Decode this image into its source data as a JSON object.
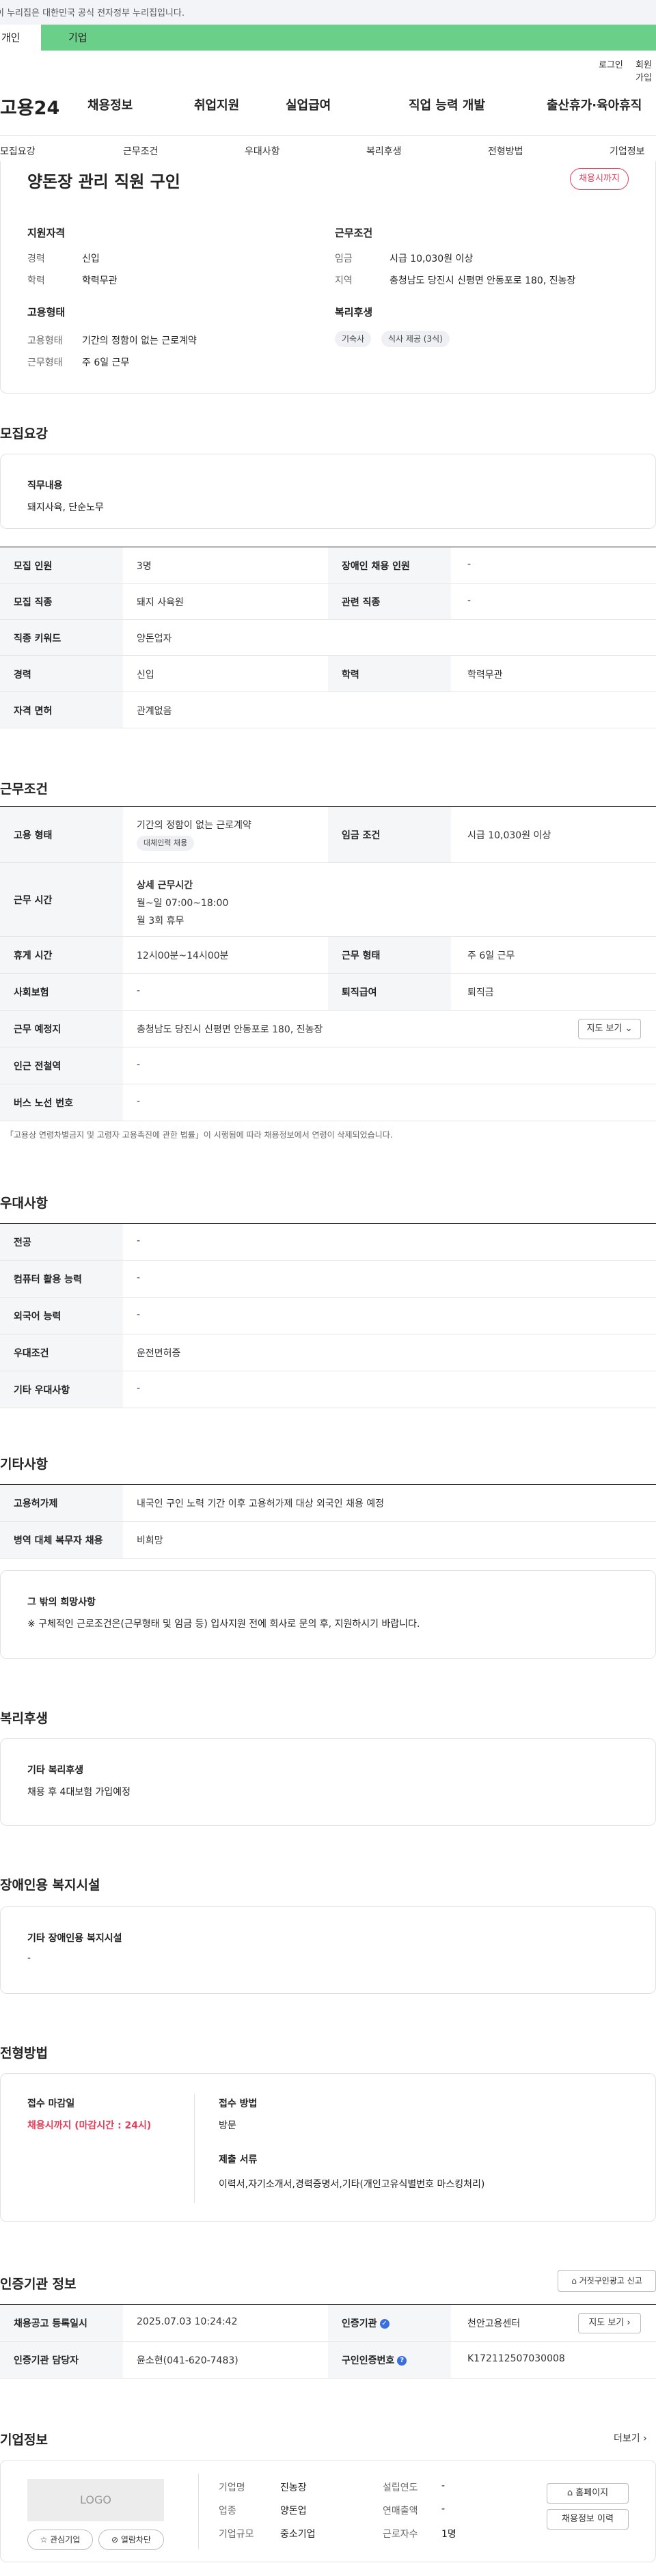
{
  "gov_banner": "이 누리집은 대한민국 공식 전자정부 누리집입니다.",
  "top_tabs": [
    "개인",
    "기업"
  ],
  "util": {
    "login": "로그인",
    "join": "회원가입"
  },
  "site": {
    "logo": "고용24"
  },
  "gnb": [
    "채용정보",
    "취업지원",
    "실업급여",
    "직업 능력 개발",
    "출산휴가·육아휴직"
  ],
  "subnav": [
    "모집요강",
    "근무조건",
    "우대사항",
    "복리후생",
    "전형방법",
    "기업정보"
  ],
  "job": {
    "title": "양돈장 관리 직원 구인",
    "status": "채용시까지",
    "qual_title": "지원자격",
    "qual": [
      {
        "k": "경력",
        "v": "신입"
      },
      {
        "k": "학력",
        "v": "학력무관"
      }
    ],
    "cond_title": "근무조건",
    "cond": [
      {
        "k": "임금",
        "v": "시급 10,030원 이상"
      },
      {
        "k": "지역",
        "v": "충청남도 당진시 신평면 안동포로 180, 진농장"
      }
    ],
    "type_title": "고용형태",
    "type": [
      {
        "k": "고용형태",
        "v": "기간의 정함이 없는 근로계약"
      },
      {
        "k": "근무형태",
        "v": "주 6일 근무"
      }
    ],
    "welfare_title": "복리후생",
    "welfare_chips": [
      "기숙사",
      "식사 제공 (3식)"
    ]
  },
  "recruit": {
    "title": "모집요강",
    "duty_label": "직무내용",
    "duty_value": "돼지사육, 단순노무",
    "rows": [
      {
        "k1": "모집 인원",
        "v1": "3명",
        "k2": "장애인 채용 인원",
        "v2": "-"
      },
      {
        "k1": "모집 직종",
        "v1": "돼지 사육원",
        "k2": "관련 직종",
        "v2": "-"
      },
      {
        "k1": "직종 키워드",
        "v1": "양돈업자"
      },
      {
        "k1": "경력",
        "v1": "신입",
        "k2": "학력",
        "v2": "학력무관"
      },
      {
        "k1": "자격 면허",
        "v1": "관계없음"
      }
    ]
  },
  "work": {
    "title": "근무조건",
    "employ_k": "고용 형태",
    "employ_v": "기간의 정함이 없는 근로계약",
    "employ_chip": "대체인력 채용",
    "wage_k": "임금 조건",
    "wage_v": "시급 10,030원 이상",
    "hours_k": "근무 시간",
    "hours_label": "상세 근무시간",
    "hours_v1": "월~일 07:00~18:00",
    "hours_v2": "월 3회 휴무",
    "rest_k": "휴게 시간",
    "rest_v": "12시00분~14시00분",
    "shift_k": "근무 형태",
    "shift_v": "주 6일 근무",
    "ins_k": "사회보험",
    "ins_v": "-",
    "sev_k": "퇴직급여",
    "sev_v": "퇴직금",
    "place_k": "근무 예정지",
    "place_v": "충청남도 당진시 신평면 안동포로 180, 진농장",
    "map_btn": "지도 보기",
    "sub_k": "인근 전철역",
    "sub_v": "-",
    "bus_k": "버스 노선 번호",
    "bus_v": "-",
    "note": "「고용상 연령차별금지 및 고령자 고용촉진에 관한 법률」이 시행됨에 따라 채용정보에서 연령이 삭제되었습니다."
  },
  "pref": {
    "title": "우대사항",
    "rows": [
      {
        "k": "전공",
        "v": "-"
      },
      {
        "k": "컴퓨터 활용 능력",
        "v": "-"
      },
      {
        "k": "외국어 능력",
        "v": "-"
      },
      {
        "k": "우대조건",
        "v": "운전면허증"
      },
      {
        "k": "기타 우대사항",
        "v": "-"
      }
    ]
  },
  "etc": {
    "title": "기타사항",
    "rows": [
      {
        "k": "고용허가제",
        "v": "내국인 구인 노력 기간 이후 고용허가제 대상 외국인 채용 예정"
      },
      {
        "k": "병역 대체 복무자 채용",
        "v": "비희망"
      }
    ],
    "hope_label": "그 밖의 희망사항",
    "hope_value": "※ 구체적인 근로조건은(근무형태 및 임금 등) 입사지원 전에 회사로 문의 후, 지원하시기 바랍니다."
  },
  "welfare": {
    "title": "복리후생",
    "label": "기타 복리후생",
    "value": "채용 후 4대보험 가입예정"
  },
  "disabled": {
    "title": "장애인용 복지시설",
    "label": "기타 장애인용 복지시설",
    "value": "-"
  },
  "selection": {
    "title": "전형방법",
    "deadline_label": "접수 마감일",
    "deadline_value": "채용시까지 (마감시간 : 24시)",
    "method_label": "접수 방법",
    "method_value": "방문",
    "docs_label": "제출 서류",
    "docs_value": "이력서,자기소개서,경력증명서,기타(개인고유식별번호 마스킹처리)"
  },
  "cert": {
    "title": "인증기관 정보",
    "report_btn": "거짓구인광고 신고",
    "reg_k": "채용공고 등록일시",
    "reg_v": "2025.07.03 10:24:42",
    "org_k": "인증기관",
    "org_v": "천안고용센터",
    "map_btn": "지도 보기",
    "staff_k": "인증기관 담당자",
    "staff_v": "윤소현(041-620-7483)",
    "num_k": "구인인증번호",
    "num_v": "K172112507030008"
  },
  "company": {
    "title": "기업정보",
    "more": "더보기",
    "logo": "LOGO",
    "fav_btn": "관심기업",
    "block_btn": "열람차단",
    "fields": [
      {
        "k": "기업명",
        "v": "진농장"
      },
      {
        "k": "업종",
        "v": "양돈업"
      },
      {
        "k": "기업규모",
        "v": "중소기업"
      }
    ],
    "fields2": [
      {
        "k": "설립연도",
        "v": "-"
      },
      {
        "k": "연매출액",
        "v": "-"
      },
      {
        "k": "근로자수",
        "v": "1명"
      }
    ],
    "home_btn": "홈페이지",
    "history_btn": "채용정보 이력"
  },
  "colors": {
    "accent_red": "#e73c5a",
    "tab_green": "#6ad089"
  }
}
